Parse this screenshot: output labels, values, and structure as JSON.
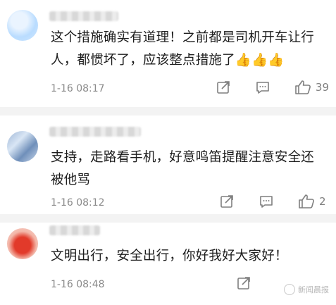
{
  "comments": [
    {
      "text": "这个措施确实有道理！之前都是司机开车让行人，都惯坏了，应该整点措施了👍👍👍",
      "time": "1-16 08:17",
      "likes": "39"
    },
    {
      "text": "支持，走路看手机，好意鸣笛提醒注意安全还被他骂",
      "time": "1-16 08:12",
      "likes": "2"
    },
    {
      "text": "文明出行，安全出行，你好我好大家好！",
      "time": "1-16 08:48",
      "likes": ""
    }
  ],
  "watermark": "新闻晨报",
  "icons": [
    "share-icon",
    "comment-icon",
    "like-icon"
  ]
}
